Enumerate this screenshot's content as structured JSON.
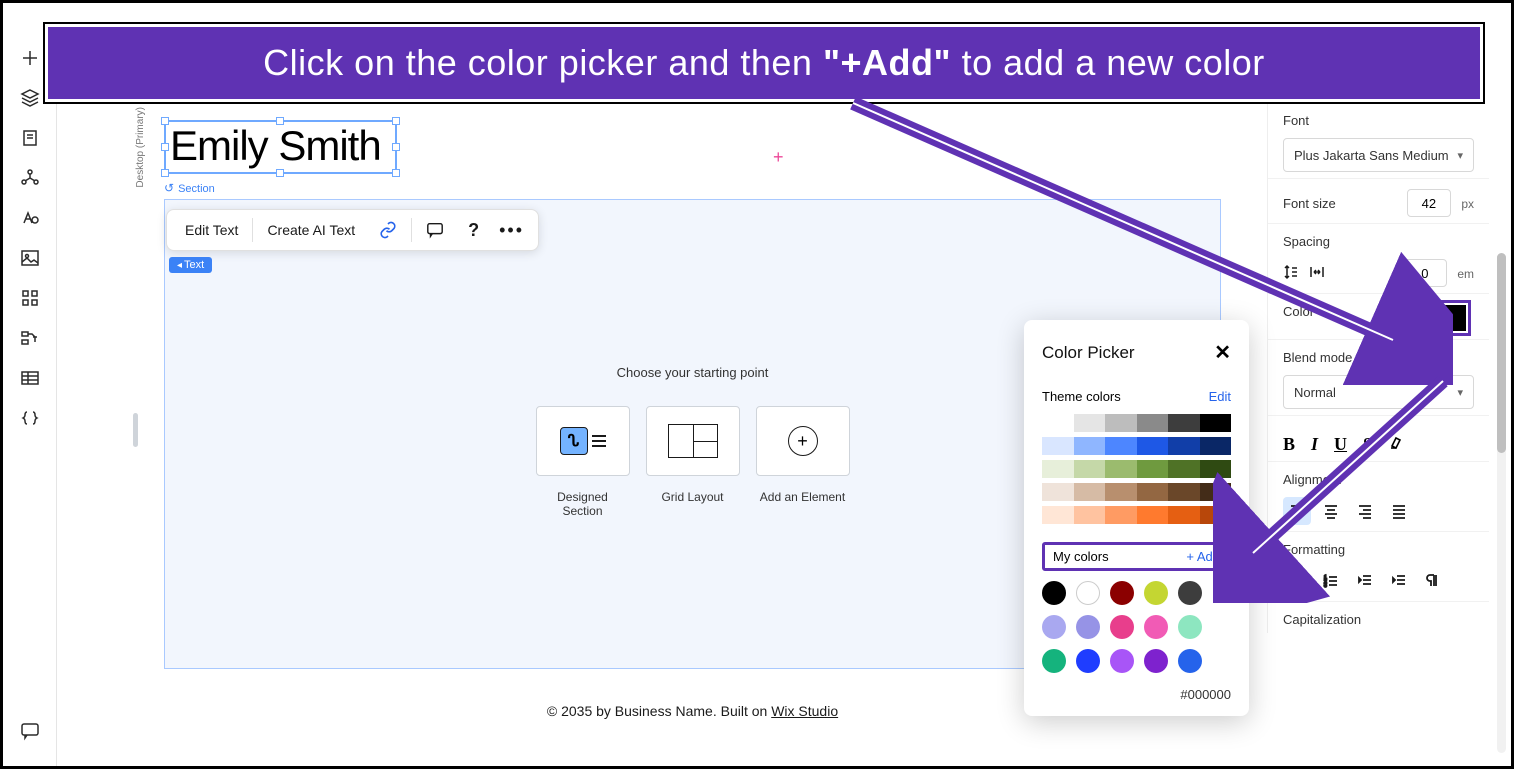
{
  "banner": {
    "text": "Click on the color picker and then \"+Add\" to add a new color"
  },
  "canvas": {
    "heading": "Emily Smith",
    "breakpointLabel": "Desktop (Primary)",
    "sectionLabel": "Section",
    "textTag": "Text",
    "startTitle": "Choose your starting point",
    "cards": {
      "designed": "Designed Section",
      "grid": "Grid Layout",
      "element": "Add an Element"
    }
  },
  "floatToolbar": {
    "editText": "Edit Text",
    "createAI": "Create AI Text"
  },
  "footer": {
    "prefix": "© 2035 by Business Name. Built on ",
    "link": "Wix Studio"
  },
  "panel": {
    "fontLabel": "Font",
    "fontValue": "Plus Jakarta Sans Medium",
    "sizeLabel": "Font size",
    "sizeValue": "42",
    "sizeUnit": "px",
    "spacingLabel": "Spacing",
    "spacingValue": "0",
    "spacingUnit": "em",
    "colorLabel": "Color",
    "blendLabel": "Blend mode",
    "blendValue": "Normal",
    "alignLabel": "Alignment",
    "formatLabel": "Formatting",
    "capLabel": "Capitalization"
  },
  "picker": {
    "title": "Color Picker",
    "themeLabel": "Theme colors",
    "edit": "Edit",
    "myColors": "My colors",
    "add": "+ Add",
    "hex": "#000000",
    "themeRows": [
      [
        "#ffffff",
        "#e5e5e5",
        "#bdbdbd",
        "#8a8a8a",
        "#3d3d3d",
        "#000000"
      ],
      [
        "#d9e6ff",
        "#8fb6ff",
        "#4d86ff",
        "#1e58e6",
        "#113ea8",
        "#0a2766"
      ],
      [
        "#e7efda",
        "#c5d8a8",
        "#9bbb6e",
        "#6f9a3f",
        "#4f7226",
        "#2f4a12"
      ],
      [
        "#efe3da",
        "#d6bba5",
        "#b88f6e",
        "#936742",
        "#6a4729",
        "#432c18"
      ],
      [
        "#ffe6d6",
        "#ffc3a0",
        "#ff9b63",
        "#ff7a2e",
        "#e55f12",
        "#b8470a"
      ]
    ],
    "myColorChips": [
      "#000000",
      "#ffffff",
      "#8b0000",
      "#c4d632",
      "#3d3d3d",
      "#a9a8f0",
      "#9693e6",
      "#e83e8c",
      "#f15bb5",
      "#8de6c0",
      "#15b37d",
      "#1f3dff",
      "#a855f7",
      "#7e22ce",
      "#2563eb"
    ]
  }
}
